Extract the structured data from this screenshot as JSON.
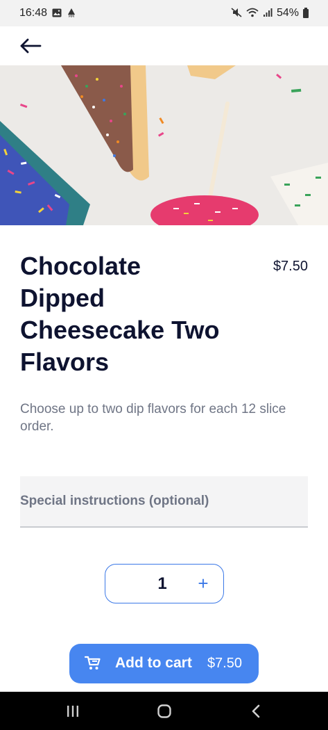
{
  "status_bar": {
    "time": "16:48",
    "left_icons": [
      "image-icon",
      "location-notification-icon"
    ],
    "right_icons": [
      "mute-icon",
      "wifi-icon",
      "signal-icon"
    ],
    "battery": "54%"
  },
  "top_bar": {
    "back_icon": "arrow-left-icon"
  },
  "hero_image": {
    "description_icon": "dessert-photo"
  },
  "product": {
    "title": "Chocolate Dipped Cheesecake Two Flavors",
    "price": "$7.50",
    "description": "Choose up to two dip flavors for each 12 slice order."
  },
  "instructions": {
    "placeholder": "Special instructions (optional)"
  },
  "quantity": {
    "value": "1",
    "plus_label": "+"
  },
  "cart_button": {
    "label": "Add to cart",
    "price": "$7.50",
    "icon": "cart-icon"
  },
  "nav_bar": {
    "icons": [
      "recents-icon",
      "home-icon",
      "back-icon"
    ]
  },
  "colors": {
    "accent": "#4786f0",
    "text": "#0e1330",
    "muted": "#6f7585",
    "field_bg": "#f4f4f5"
  }
}
